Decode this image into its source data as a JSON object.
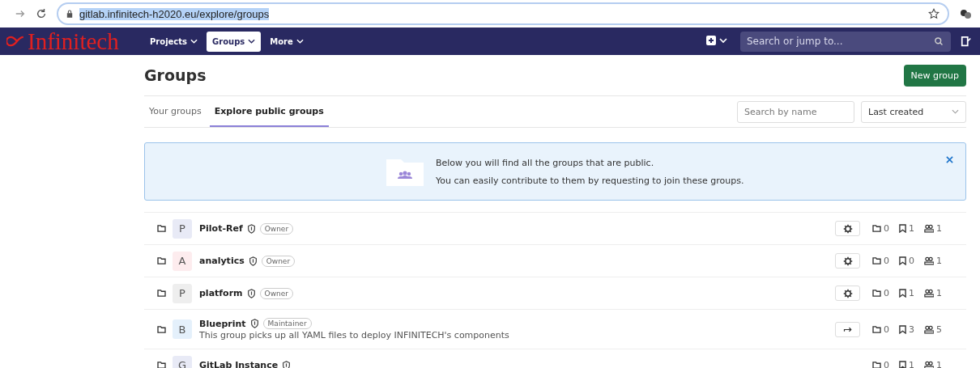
{
  "browser": {
    "url": "gitlab.infinitech-h2020.eu/explore/groups",
    "url_selected": true
  },
  "navbar": {
    "logo": "Infinitech",
    "menus": [
      {
        "label": "Projects",
        "selected": false
      },
      {
        "label": "Groups",
        "selected": true
      },
      {
        "label": "More",
        "selected": false
      }
    ],
    "search": {
      "placeholder": "Search or jump to..."
    }
  },
  "page": {
    "title": "Groups",
    "new_button": "New group"
  },
  "tabs": [
    {
      "label": "Your groups",
      "selected": false
    },
    {
      "label": "Explore public groups",
      "selected": true
    }
  ],
  "filter": {
    "placeholder": "Search by name",
    "sort": "Last created"
  },
  "banner": {
    "lines": [
      "Below you will find all the groups that are public.",
      "You can easily contribute to them by requesting to join these groups."
    ]
  },
  "groups": [
    {
      "letter": "P",
      "color": "#e8eaf6",
      "name": "Pilot-Ref",
      "role": "Owner",
      "kind": "settings",
      "subgroups": "0",
      "projects": "1",
      "members": "1"
    },
    {
      "letter": "A",
      "color": "#fdecee",
      "name": "analytics",
      "role": "Owner",
      "kind": "settings",
      "subgroups": "0",
      "projects": "0",
      "members": "1"
    },
    {
      "letter": "P",
      "color": "#eeeeee",
      "name": "platform",
      "role": "Owner",
      "kind": "settings",
      "subgroups": "0",
      "projects": "1",
      "members": "1"
    },
    {
      "letter": "B",
      "color": "#e4f0fb",
      "name": "Blueprint",
      "role": "Maintainer",
      "description": "This group picks up all YAML files to deploy INFINITECH's components",
      "kind": "leave",
      "subgroups": "0",
      "projects": "3",
      "members": "5"
    },
    {
      "letter": "G",
      "color": "#e8eaf6",
      "name": "GitLab Instance",
      "subgroups": "0",
      "projects": "1",
      "members": "1"
    }
  ]
}
